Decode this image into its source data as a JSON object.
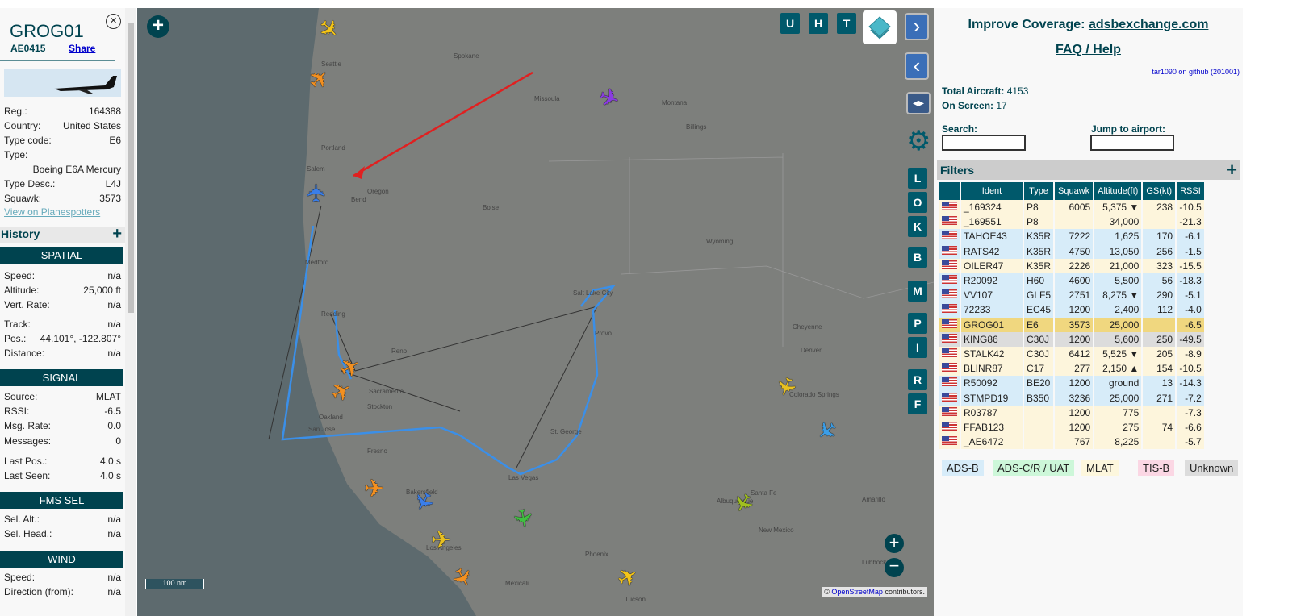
{
  "selected": {
    "callsign": "GROG01",
    "hex": "AE0415",
    "share_label": "Share",
    "planespotters_label": "View on Planespotters",
    "details": [
      {
        "label": "Reg.:",
        "value": "164388"
      },
      {
        "label": "Country:",
        "value": "United States"
      },
      {
        "label": "Type code:",
        "value": "E6"
      },
      {
        "label": "Type:",
        "value": ""
      },
      {
        "label": "",
        "value": "Boeing E6A Mercury"
      },
      {
        "label": "Type Desc.:",
        "value": "L4J"
      },
      {
        "label": "Squawk:",
        "value": "3573"
      }
    ],
    "history_label": "History",
    "sections": [
      {
        "title": "SPATIAL",
        "rows": [
          {
            "label": "Speed:",
            "value": "n/a"
          },
          {
            "label": "Altitude:",
            "value": "25,000 ft"
          },
          {
            "label": "Vert. Rate:",
            "value": "n/a"
          },
          {
            "label": "Track:",
            "value": "n/a"
          },
          {
            "label": "Pos.:",
            "value": "44.101°, -122.807°"
          },
          {
            "label": "Distance:",
            "value": "n/a"
          }
        ]
      },
      {
        "title": "SIGNAL",
        "rows": [
          {
            "label": "Source:",
            "value": "MLAT"
          },
          {
            "label": "RSSI:",
            "value": "-6.5"
          },
          {
            "label": "Msg. Rate:",
            "value": "0.0"
          },
          {
            "label": "Messages:",
            "value": "0"
          },
          {
            "label": "Last Pos.:",
            "value": "4.0 s"
          },
          {
            "label": "Last Seen:",
            "value": "4.0 s"
          }
        ]
      },
      {
        "title": "FMS SEL",
        "rows": [
          {
            "label": "Sel. Alt.:",
            "value": "n/a"
          },
          {
            "label": "Sel. Head.:",
            "value": "n/a"
          }
        ]
      },
      {
        "title": "WIND",
        "rows": [
          {
            "label": "Speed:",
            "value": "n/a"
          },
          {
            "label": "Direction (from):",
            "value": "n/a"
          }
        ]
      }
    ]
  },
  "map": {
    "toggles": [
      "U",
      "H",
      "T"
    ],
    "layer_buttons": [
      "L",
      "O",
      "K",
      "B",
      "M",
      "P",
      "I",
      "R",
      "F"
    ],
    "scale": "100 nm",
    "attribution_prefix": "©",
    "attribution_link": "OpenStreetMap",
    "attribution_suffix": "contributors.",
    "labels": [
      "Seattle",
      "Spokane",
      "Portland",
      "Salem",
      "Missoula",
      "Billings",
      "Boise",
      "Bend",
      "Medford",
      "Redding",
      "Reno",
      "Sacramento",
      "Oakland",
      "San Jose",
      "Fresno",
      "Salt Lake City",
      "Provo",
      "Las Vegas",
      "Los Angeles",
      "Phoenix",
      "Denver",
      "Colorado Springs",
      "Cheyenne",
      "Santa Fe",
      "Albuquerque",
      "Wyoming",
      "Oregon",
      "Montana",
      "St. George",
      "Stockton",
      "Bakersfield",
      "Mexicali",
      "Tucson",
      "Amarillo",
      "Lubbock",
      "New Mexico"
    ],
    "plane_colors": [
      "#f5c518",
      "#f39020",
      "#8a3ce0",
      "#3b7ee8",
      "#f39020",
      "#f39020",
      "#f39020",
      "#e8c020",
      "#3b9ee8",
      "#40c040",
      "#3b7ee8",
      "#f5c518",
      "#a0c020",
      "#e8c020",
      "#f39020"
    ],
    "path_color": "#3b8fe8",
    "arrow_color": "#e02020"
  },
  "right": {
    "improve_label": "Improve Coverage:",
    "improve_link": "adsbexchange.com",
    "faq": "FAQ / Help",
    "github": "tar1090 on github (201001)",
    "total_label": "Total Aircraft:",
    "total": "4153",
    "onscreen_label": "On Screen:",
    "onscreen": "17",
    "search_label": "Search:",
    "search_value": "",
    "airport_label": "Jump to airport:",
    "airport_value": "",
    "filters_label": "Filters",
    "columns": [
      "",
      "Ident",
      "Type",
      "Squawk",
      "Altitude(ft)",
      "GS(kt)",
      "RSSI"
    ],
    "rows": [
      [
        "_169324",
        "P8",
        "6005",
        "5,375 ▼",
        "238",
        "-10.5",
        "mlat"
      ],
      [
        "_169551",
        "P8",
        "",
        "34,000",
        "",
        "-21.3",
        "mlat"
      ],
      [
        "TAHOE43",
        "K35R",
        "7222",
        "1,625",
        "170",
        "-6.1",
        "adsb"
      ],
      [
        "RATS42",
        "K35R",
        "4750",
        "13,050",
        "256",
        "-1.5",
        "adsb"
      ],
      [
        "OILER47",
        "K35R",
        "2226",
        "21,000",
        "323",
        "-15.5",
        "mlat"
      ],
      [
        "R20092",
        "H60",
        "4600",
        "5,500",
        "56",
        "-18.3",
        "adsb"
      ],
      [
        "VV107",
        "GLF5",
        "2751",
        "8,275 ▼",
        "290",
        "-5.1",
        "adsb"
      ],
      [
        "72233",
        "EC45",
        "1200",
        "2,400",
        "112",
        "-4.0",
        "adsb"
      ],
      [
        "GROG01",
        "E6",
        "3573",
        "25,000",
        "",
        "-6.5",
        "selected"
      ],
      [
        "KING86",
        "C30J",
        "1200",
        "5,600",
        "250",
        "-49.5",
        "unknown"
      ],
      [
        "STALK42",
        "C30J",
        "6412",
        "5,525 ▼",
        "205",
        "-8.9",
        "mlat"
      ],
      [
        "BLINR87",
        "C17",
        "277",
        "2,150 ▲",
        "154",
        "-10.5",
        "mlat"
      ],
      [
        "R50092",
        "BE20",
        "1200",
        "ground",
        "13",
        "-14.3",
        "adsb"
      ],
      [
        "STMPD19",
        "B350",
        "3236",
        "25,000",
        "271",
        "-7.2",
        "adsb"
      ],
      [
        "R03787",
        "",
        "1200",
        "775",
        "",
        "-7.3",
        "mlat"
      ],
      [
        "FFAB123",
        "",
        "1200",
        "275",
        "74",
        "-6.6",
        "mlat"
      ],
      [
        "_AE6472",
        "",
        "767",
        "8,225",
        "",
        "-5.7",
        "mlat"
      ]
    ],
    "legend": [
      {
        "label": "ADS-B",
        "color": "#d7ecf9"
      },
      {
        "label": "ADS-C/R / UAT",
        "color": "#cdf7d9"
      },
      {
        "label": "MLAT",
        "color": "#fdf7dd"
      },
      {
        "label": "TIS-B",
        "color": "#fbd7e4"
      },
      {
        "label": "Unknown",
        "color": "#dcdcdc"
      }
    ],
    "row_colors": {
      "mlat": "#fdf5dc",
      "adsb": "#d7ecf9",
      "selected": "#f0d77f",
      "unknown": "#dcdcdc"
    }
  }
}
